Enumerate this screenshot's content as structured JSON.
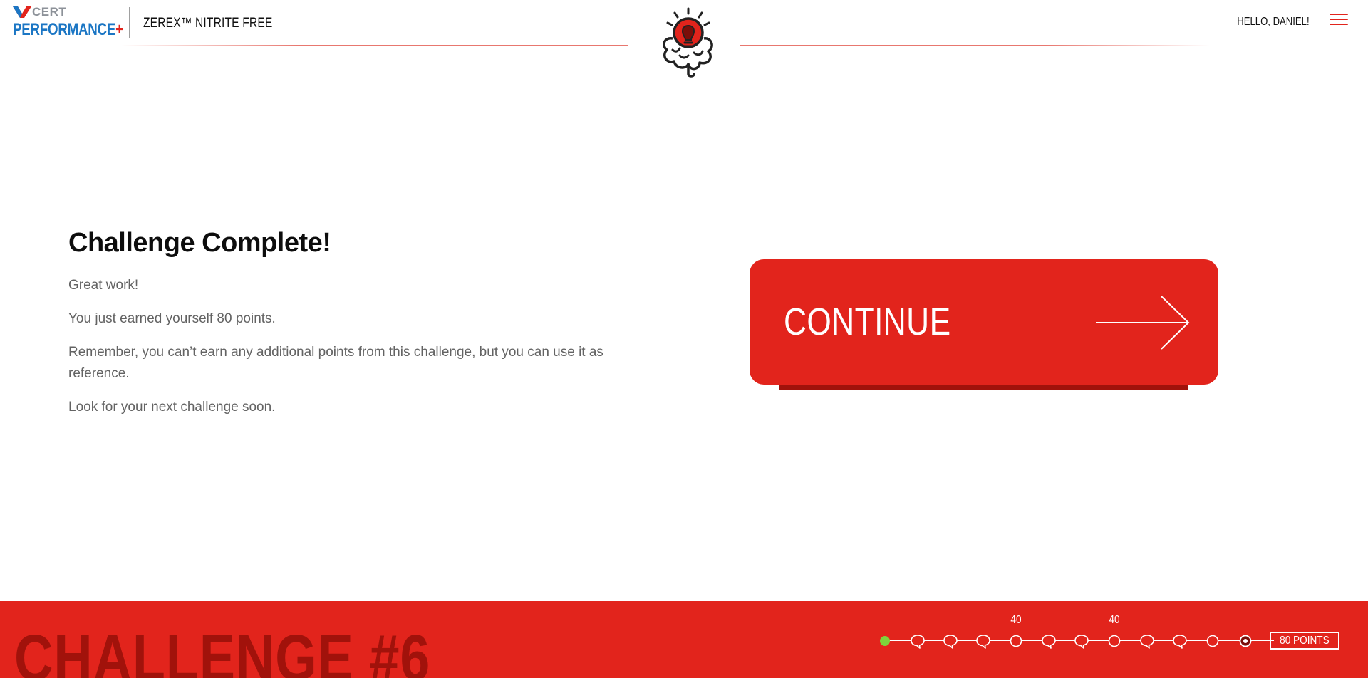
{
  "header": {
    "logo": {
      "top_text": "CERT",
      "bottom_text": "PERFORMANCE",
      "plus": "+"
    },
    "product_name": "ZEREX™ NITRITE FREE",
    "greeting": "HELLO, DANIEL!",
    "colors": {
      "brand_blue": "#1b76c4",
      "brand_red": "#e2241c",
      "logo_gray": "#8d9299"
    }
  },
  "main": {
    "title": "Challenge Complete!",
    "paragraphs": [
      "Great work!",
      "You just earned yourself 80 points.",
      "Remember, you can’t earn any additional points from this challenge, but you can use it as reference.",
      "Look for your next challenge soon."
    ],
    "continue_label": "CONTINUE"
  },
  "footer": {
    "challenge_label": "CHALLENGE #6",
    "total_points": "80 POINTS",
    "nodes": [
      {
        "type": "start-dot",
        "label": ""
      },
      {
        "type": "speech-bubble",
        "label": ""
      },
      {
        "type": "speech-bubble",
        "label": ""
      },
      {
        "type": "speech-bubble",
        "label": ""
      },
      {
        "type": "circle",
        "label": "40"
      },
      {
        "type": "speech-bubble",
        "label": ""
      },
      {
        "type": "speech-bubble",
        "label": ""
      },
      {
        "type": "circle",
        "label": "40"
      },
      {
        "type": "speech-bubble",
        "label": ""
      },
      {
        "type": "speech-bubble",
        "label": ""
      },
      {
        "type": "circle",
        "label": ""
      },
      {
        "type": "current-target",
        "label": ""
      }
    ],
    "colors": {
      "bg": "#e2241c",
      "title": "#a1120b",
      "start_dot": "#7ed33b"
    }
  }
}
